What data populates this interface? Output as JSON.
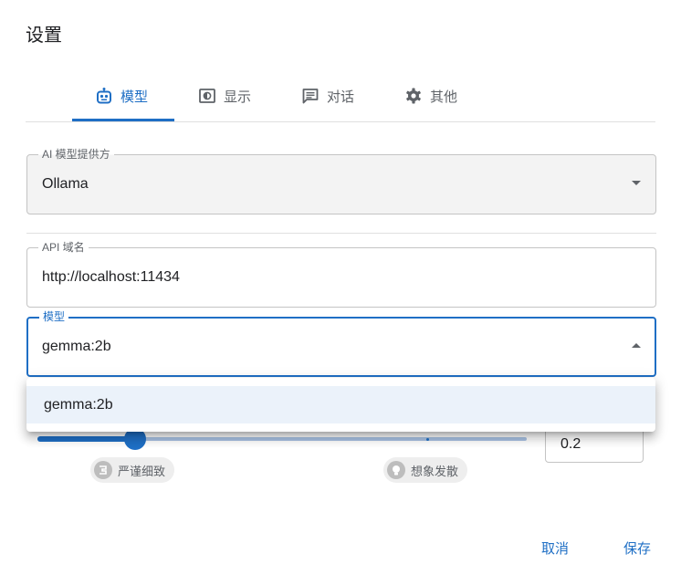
{
  "dialog": {
    "title": "设置"
  },
  "tabs": [
    {
      "label": "模型",
      "icon": "robot-icon",
      "active": true
    },
    {
      "label": "显示",
      "icon": "display-icon",
      "active": false
    },
    {
      "label": "对话",
      "icon": "chat-icon",
      "active": false
    },
    {
      "label": "其他",
      "icon": "gear-icon",
      "active": false
    }
  ],
  "fields": {
    "provider": {
      "label": "AI 模型提供方",
      "value": "Ollama"
    },
    "api_host": {
      "label": "API 域名",
      "value": "http://localhost:11434"
    },
    "model": {
      "label": "模型",
      "value": "gemma:2b"
    }
  },
  "model_menu": {
    "options": [
      "gemma:2b"
    ]
  },
  "temperature": {
    "value": "0.2",
    "low_label": "严谨细致",
    "high_label": "想象发散",
    "low_icon": "precise-icon",
    "high_icon": "lightbulb-icon"
  },
  "actions": {
    "cancel": "取消",
    "save": "保存"
  },
  "colors": {
    "accent": "#1f6fc5",
    "menu_highlight": "#ebf2fa"
  }
}
